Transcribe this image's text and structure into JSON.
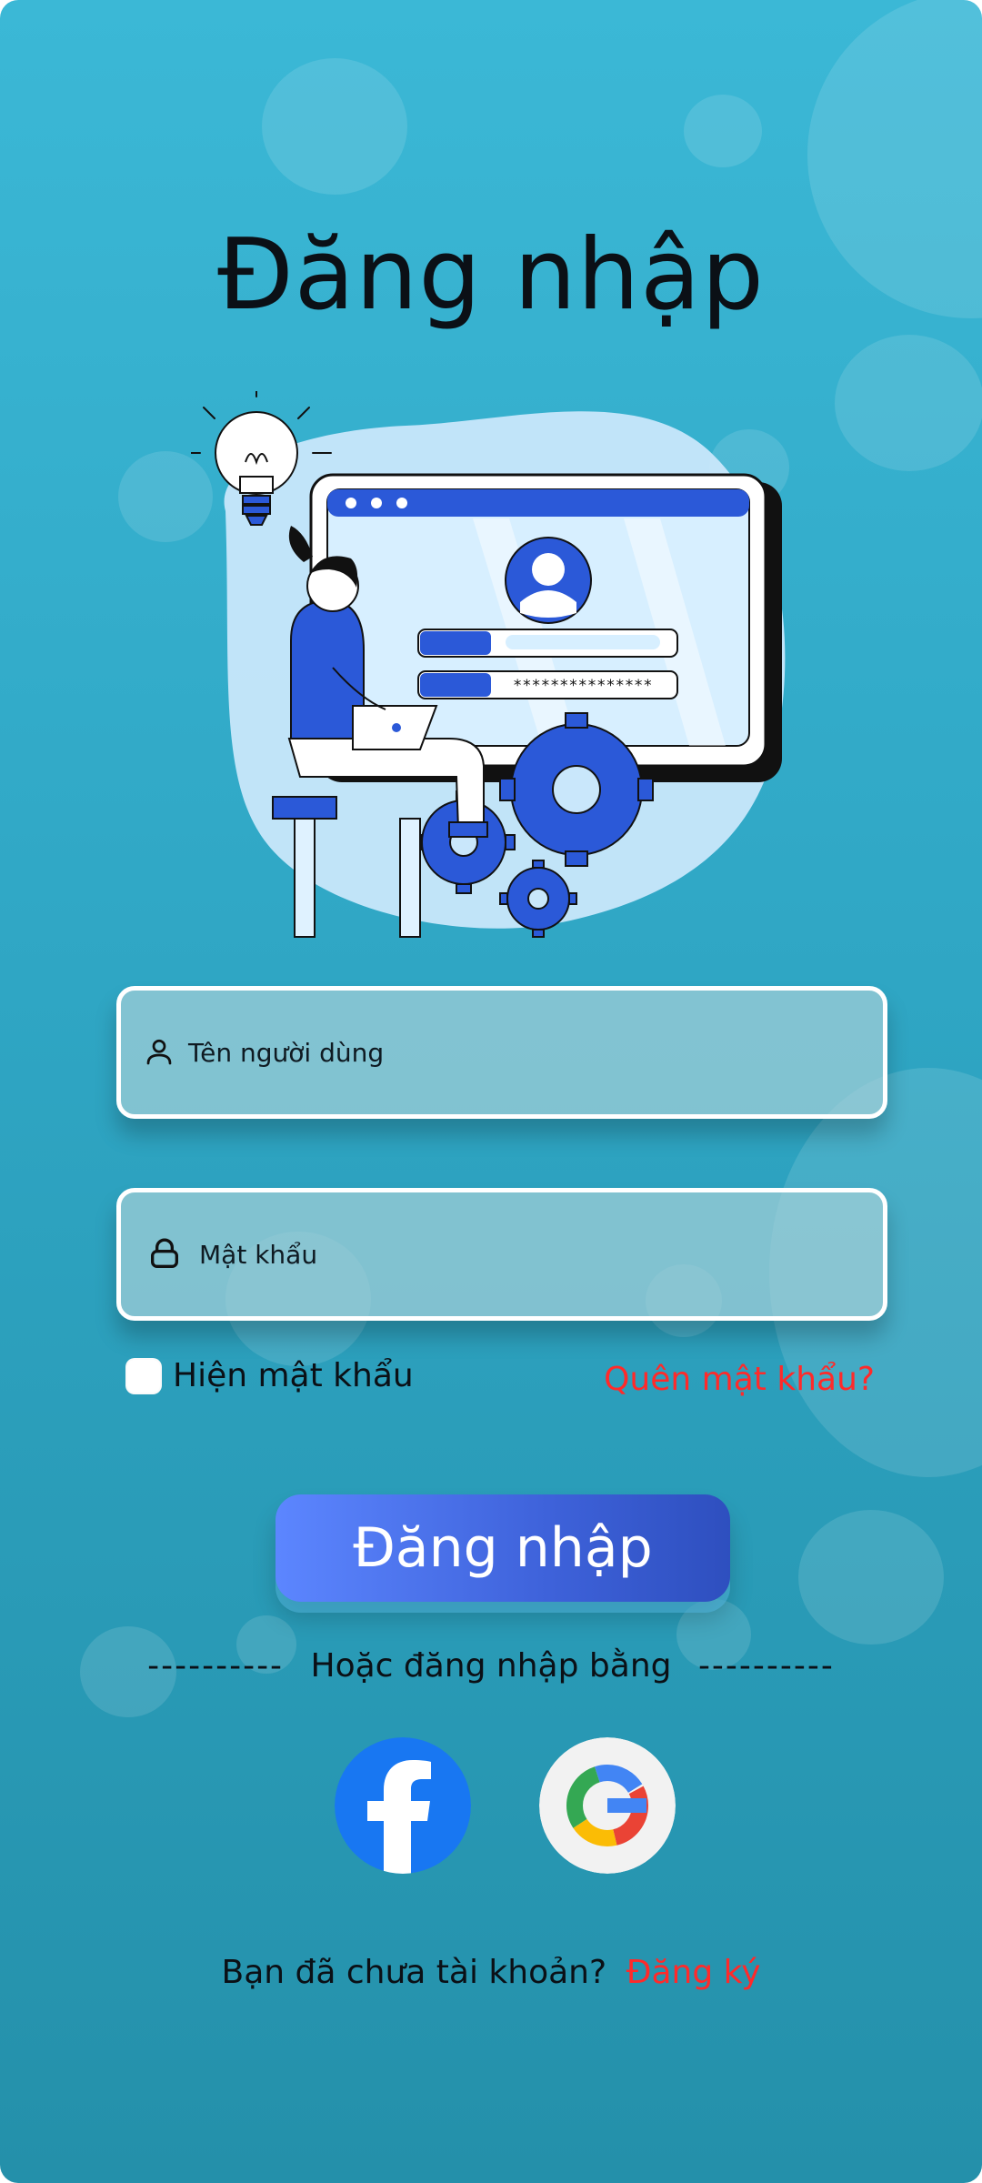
{
  "screen": {
    "title": "Đăng nhập",
    "background_start": "#3bb8d6",
    "background_end": "#2490aa",
    "accent_red": "#ff2a2a",
    "button_blue": "#4a72f0"
  },
  "form": {
    "username_placeholder": "Tên người dùng",
    "password_placeholder": "Mật khẩu",
    "show_password_label": "Hiện mật khẩu",
    "forgot_password": "Quên mật khẩu?",
    "login_button": "Đăng nhập",
    "user_icon": "user-icon",
    "lock_icon": "lock-icon"
  },
  "social": {
    "separator_left": "----------",
    "separator_text": "Hoặc đăng nhập bằng",
    "separator_right": "----------",
    "facebook_icon": "facebook-icon",
    "google_icon": "google-icon"
  },
  "footer": {
    "question": "Bạn đã chưa tài khoản?",
    "register": "Đăng ký"
  },
  "illustration": {
    "password_mask": "***************"
  }
}
